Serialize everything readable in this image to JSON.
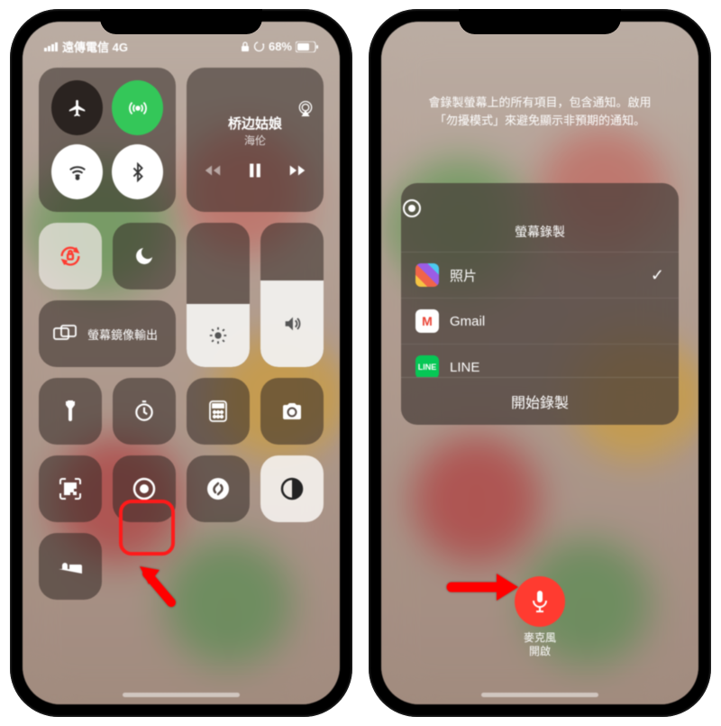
{
  "status": {
    "carrier": "遠傳電信 4G",
    "battery": "68%"
  },
  "media": {
    "title": "桥边姑娘",
    "artist": "海伦"
  },
  "mirror": {
    "label": "螢幕鏡像輸出"
  },
  "right": {
    "info_line1": "會錄製螢幕上的所有項目，包含通知。啟用",
    "info_line2": "「勿擾模式」來避免顯示非預期的通知。",
    "sheet_title": "螢幕錄製",
    "apps": [
      {
        "name": "照片",
        "icon": "photos",
        "selected": true
      },
      {
        "name": "Gmail",
        "icon": "gmail",
        "selected": false
      },
      {
        "name": "LINE",
        "icon": "line",
        "selected": false
      }
    ],
    "start_label": "開始錄製",
    "mic_label_line1": "麥克風",
    "mic_label_line2": "開啟"
  }
}
